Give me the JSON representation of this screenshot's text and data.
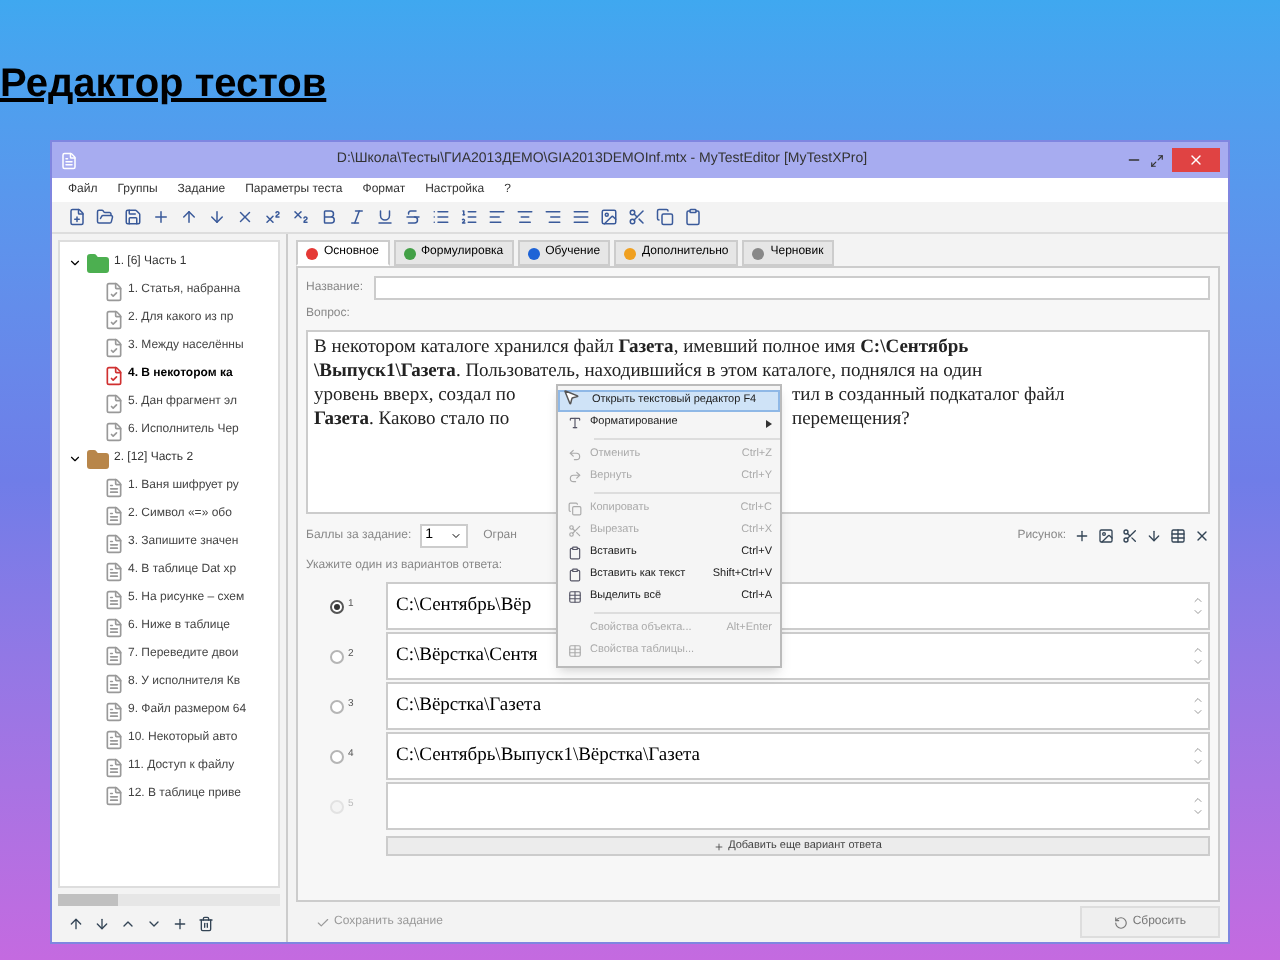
{
  "slide_title": "Редактор тестов",
  "window": {
    "title": "D:\\Школа\\Тесты\\ГИА2013ДЕМО\\GIA2013DEMOInf.mtx - MyTestEditor [MyTestXPro]"
  },
  "menu": [
    "Файл",
    "Группы",
    "Задание",
    "Параметры теста",
    "Формат",
    "Настройка",
    "?"
  ],
  "tree": [
    {
      "label": "1. [6] Часть 1",
      "expanded": true,
      "color": "#4caf50",
      "children": [
        {
          "label": "1. Статья, набранна",
          "selected": false,
          "kind": "checked"
        },
        {
          "label": "2. Для какого из пр",
          "selected": false,
          "kind": "checked"
        },
        {
          "label": "3. Между населённы",
          "selected": false,
          "kind": "checked"
        },
        {
          "label": "4. В некотором ка",
          "selected": true,
          "kind": "checked"
        },
        {
          "label": "5. Дан фрагмент эл",
          "selected": false,
          "kind": "checked"
        },
        {
          "label": "6. Исполнитель Чер",
          "selected": false,
          "kind": "checked"
        }
      ]
    },
    {
      "label": "2. [12] Часть 2",
      "expanded": true,
      "color": "#b8864a",
      "children": [
        {
          "label": "1. Ваня шифрует ру",
          "selected": false,
          "kind": "plain"
        },
        {
          "label": "2. Символ «=» обо",
          "selected": false,
          "kind": "plain"
        },
        {
          "label": "3. Запишите значен",
          "selected": false,
          "kind": "plain"
        },
        {
          "label": "4. В таблице Dat хр",
          "selected": false,
          "kind": "plain"
        },
        {
          "label": "5. На рисунке – схем",
          "selected": false,
          "kind": "plain"
        },
        {
          "label": "6. Ниже в таблице",
          "selected": false,
          "kind": "plain"
        },
        {
          "label": "7. Переведите двои",
          "selected": false,
          "kind": "plain"
        },
        {
          "label": "8. У исполнителя Кв",
          "selected": false,
          "kind": "plain"
        },
        {
          "label": "9. Файл размером 64",
          "selected": false,
          "kind": "plain"
        },
        {
          "label": "10. Некоторый авто",
          "selected": false,
          "kind": "plain"
        },
        {
          "label": "11. Доступ к файлу",
          "selected": false,
          "kind": "plain"
        },
        {
          "label": "12. В таблице приве",
          "selected": false,
          "kind": "plain"
        }
      ]
    }
  ],
  "tabs": [
    {
      "label": "Основное",
      "selected": true,
      "color": "#e53935"
    },
    {
      "label": "Формулировка",
      "selected": false,
      "color": "#43a047"
    },
    {
      "label": "Обучение",
      "selected": false,
      "color": "#1e63d6"
    },
    {
      "label": "Дополнительно",
      "selected": false,
      "color": "#f0a020"
    },
    {
      "label": "Черновик",
      "selected": false,
      "color": "#888888"
    }
  ],
  "form": {
    "name_label": "Название:",
    "question_label": "Вопрос:",
    "question_lines": [
      [
        "В некотором каталоге хранился файл **Газета**, имевший полное имя **С:\\Сентябрь**"
      ],
      [
        "**\\Выпуск1\\Газета**. Пользователь, находившийся в этом каталоге, поднялся на один"
      ],
      [
        "уровень вверх, создал по",
        "тил в созданный подкаталог файл"
      ],
      [
        "**Газета**. Каково стало по",
        "перемещения?"
      ]
    ],
    "points_label": "Баллы за задание:",
    "points_value": "1",
    "limit_label": "Огран",
    "picture_label": "Рисунок:",
    "answers_label": "Укажите один из вариантов ответа:",
    "answers": [
      {
        "number": "1",
        "text": "С:\\Сентябрь\\Вёр",
        "selected": true,
        "disabled": false
      },
      {
        "number": "2",
        "text": "С:\\Вёрстка\\Сентя",
        "selected": false,
        "disabled": false
      },
      {
        "number": "3",
        "text": "С:\\Вёрстка\\Газета",
        "selected": false,
        "disabled": false
      },
      {
        "number": "4",
        "text": "С:\\Сентябрь\\Выпуск1\\Вёрстка\\Газета",
        "selected": false,
        "disabled": false
      },
      {
        "number": "5",
        "selected": false,
        "disabled": true
      }
    ],
    "add_answer_button": "Добавить еще вариант ответа",
    "save_button": "Сохранить задание",
    "reset_button": "Сбросить"
  },
  "context_menu": [
    {
      "kind": "item",
      "label": "Открыть текстовый редактор F4",
      "highlighted": true,
      "disabled": false
    },
    {
      "kind": "item",
      "label": "Форматирование",
      "submenu": true,
      "highlighted": false,
      "disabled": false
    },
    {
      "kind": "separator"
    },
    {
      "kind": "item",
      "label": "Отменить",
      "shortcut": "Ctrl+Z",
      "highlighted": false,
      "disabled": true
    },
    {
      "kind": "item",
      "label": "Вернуть",
      "shortcut": "Ctrl+Y",
      "highlighted": false,
      "disabled": true
    },
    {
      "kind": "separator"
    },
    {
      "kind": "item",
      "label": "Копировать",
      "shortcut": "Ctrl+C",
      "highlighted": false,
      "disabled": true
    },
    {
      "kind": "item",
      "label": "Вырезать",
      "shortcut": "Ctrl+X",
      "highlighted": false,
      "disabled": true
    },
    {
      "kind": "item",
      "label": "Вставить",
      "shortcut": "Ctrl+V",
      "highlighted": false,
      "disabled": false
    },
    {
      "kind": "item",
      "label": "Вставить как текст",
      "shortcut": "Shift+Ctrl+V",
      "highlighted": false,
      "disabled": false
    },
    {
      "kind": "item",
      "label": "Выделить всё",
      "shortcut": "Ctrl+A",
      "highlighted": false,
      "disabled": false
    },
    {
      "kind": "separator"
    },
    {
      "kind": "item",
      "label": "Свойства объекта...",
      "shortcut": "Alt+Enter",
      "highlighted": false,
      "disabled": true
    },
    {
      "kind": "item",
      "label": "Свойства таблицы...",
      "highlighted": false,
      "disabled": true
    }
  ]
}
